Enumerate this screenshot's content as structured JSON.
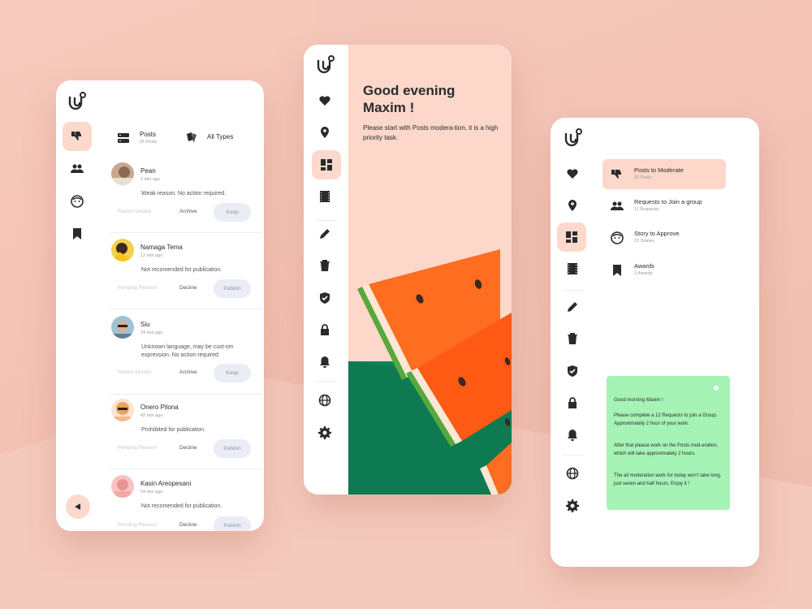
{
  "colors": {
    "accent_soft": "#fcd9cc",
    "panel_peach": "#fcd7ca",
    "note_green": "#a6f3b6",
    "watermelon_red": "#ff6d21",
    "rind_green": "#0e8458"
  },
  "card1": {
    "rail_icons": [
      "thumbs-down-icon",
      "group-icon",
      "face-icon",
      "bookmark-icon"
    ],
    "header": {
      "posts_label": "Posts",
      "posts_count": "26 Posts",
      "types_label": "All Types"
    },
    "posts": [
      {
        "name": "Pean",
        "time": "2 min ago",
        "reason": "Weak reason. No action required.",
        "action1": "Report Details",
        "action2": "Archive",
        "action3": "Keep"
      },
      {
        "name": "Namaga Tema",
        "time": "12 min ago",
        "reason": "Not recomended for publication.",
        "action1": "Pending Reason",
        "action2": "Decline",
        "action3": "Publish"
      },
      {
        "name": "Siu",
        "time": "24 min ago",
        "reason": "Unknown language, may be cust-om expression. No action required.",
        "action1": "Report Details",
        "action2": "Archive",
        "action3": "Keep"
      },
      {
        "name": "Onero Pilona",
        "time": "42 min ago",
        "reason": "Prohibited for publication.",
        "action1": "Pending Reason",
        "action2": "Decline",
        "action3": "Publish"
      },
      {
        "name": "Kasin Areopesani",
        "time": "54 min ago",
        "reason": "Not recomended for publication.",
        "action1": "Pending Reason",
        "action2": "Decline",
        "action3": "Publish"
      }
    ]
  },
  "card2": {
    "greeting": "Good evening Maxim !",
    "message": "Please start with Posts modera-tion, it is a high priority task.",
    "rail_icons": [
      "heart-icon",
      "location-icon",
      "dashboard-icon",
      "film-icon",
      "pencil-icon",
      "trash-icon",
      "shield-check-icon",
      "lock-icon",
      "bell-icon",
      "globe-icon",
      "gear-icon"
    ]
  },
  "card3": {
    "menu": [
      {
        "label": "Posts to Moderate",
        "count": "20 Posts",
        "icon": "thumbs-down-icon"
      },
      {
        "label": "Requests to Join a group",
        "count": "11 Requests",
        "icon": "group-icon"
      },
      {
        "label": "Story to Approve",
        "count": "23 Stories",
        "icon": "face-icon"
      },
      {
        "label": "Awards",
        "count": "3 Awards",
        "icon": "bookmark-icon"
      }
    ],
    "note": {
      "greeting": "Good morning Maxim !",
      "para1": "Please complete a 12 Requests to join a Group. Approximately 2 hour of your work.",
      "para2": "After that please work on the Posts mod-eration, which will take approximately 2 hours.",
      "para3": "The all moderation work for today won't take long, just seven and half hours. Enjoy it !"
    }
  }
}
